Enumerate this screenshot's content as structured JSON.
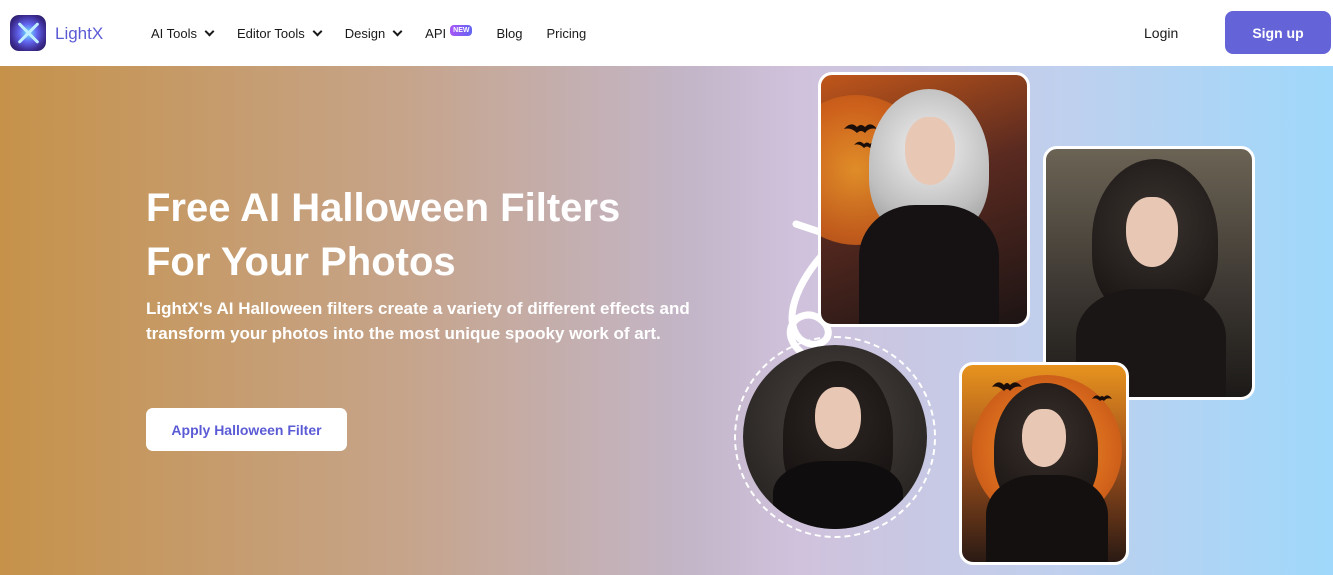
{
  "header": {
    "brand": "LightX",
    "nav": [
      {
        "label": "AI Tools",
        "dropdown": true
      },
      {
        "label": "Editor Tools",
        "dropdown": true
      },
      {
        "label": "Design",
        "dropdown": true
      },
      {
        "label": "API",
        "badge": "NEW"
      },
      {
        "label": "Blog"
      },
      {
        "label": "Pricing"
      }
    ],
    "login": "Login",
    "signup": "Sign up"
  },
  "hero": {
    "title_line1": "Free AI Halloween Filters",
    "title_line2": "For Your Photos",
    "description": "LightX's AI Halloween filters create a variety of different effects and transform your photos into the most unique spooky work of art.",
    "cta": "Apply Halloween Filter"
  },
  "colors": {
    "brand": "#5b5bd6",
    "signup_bg": "#6464d8",
    "hero_left": "#c6924a",
    "hero_right": "#9fd8fb"
  },
  "icons": [
    "lightx-logo-icon",
    "chevron-down-icon",
    "curved-arrow-icon"
  ]
}
